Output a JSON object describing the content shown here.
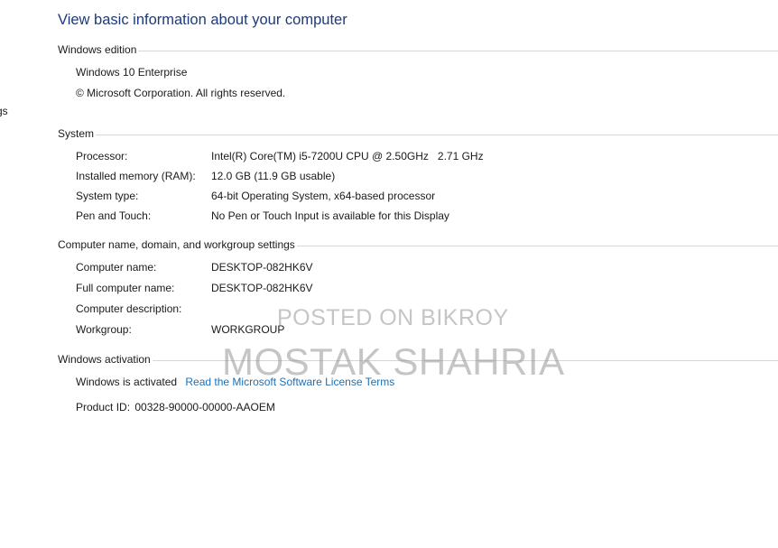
{
  "left_edge_text": "gs",
  "page_title": "View basic information about your computer",
  "windows_edition": {
    "header": "Windows edition",
    "edition": "Windows 10 Enterprise",
    "copyright": "© Microsoft Corporation. All rights reserved."
  },
  "system": {
    "header": "System",
    "rows": [
      {
        "key": "Processor:",
        "value": "Intel(R) Core(TM) i5-7200U CPU @ 2.50GHz   2.71 GHz"
      },
      {
        "key": "Installed memory (RAM):",
        "value": "12.0 GB (11.9 GB usable)"
      },
      {
        "key": "System type:",
        "value": "64-bit Operating System, x64-based processor"
      },
      {
        "key": "Pen and Touch:",
        "value": "No Pen or Touch Input is available for this Display"
      }
    ]
  },
  "computer_name": {
    "header": "Computer name, domain, and workgroup settings",
    "rows": [
      {
        "key": "Computer name:",
        "value": "DESKTOP-082HK6V"
      },
      {
        "key": "Full computer name:",
        "value": "DESKTOP-082HK6V"
      },
      {
        "key": "Computer description:",
        "value": ""
      },
      {
        "key": "Workgroup:",
        "value": "WORKGROUP"
      }
    ]
  },
  "activation": {
    "header": "Windows activation",
    "status": "Windows is activated",
    "license_link": "Read the Microsoft Software License Terms",
    "product_id_label": "Product ID:",
    "product_id": "00328-90000-00000-AAOEM"
  },
  "watermark": {
    "line1": "POSTED ON BIKROY",
    "line2": "MOSTAK SHAHRIA"
  }
}
